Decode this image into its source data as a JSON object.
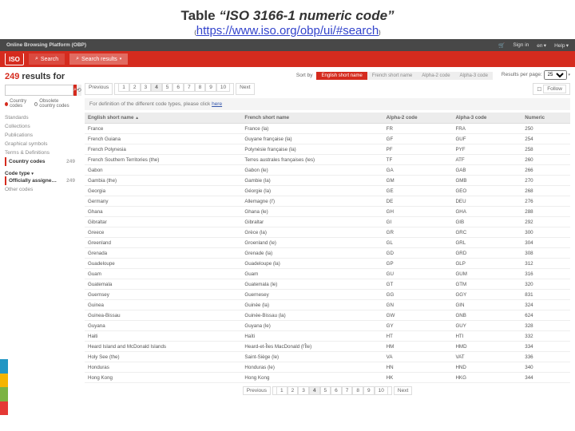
{
  "slide": {
    "title_prefix": "Table ",
    "title_quoted": "“ISO 3166-1 numeric code”",
    "url_text": "https://www.iso.org/obp/ui/#search"
  },
  "topbar": {
    "brand": "Online Browsing Platform (OBP)",
    "cart_icon": "cart-icon",
    "signin": "Sign in",
    "lang": "en ▾",
    "help": "Help ▾"
  },
  "redbar": {
    "logo": "ISO",
    "search_tab": "Search",
    "results_tab": "Search results"
  },
  "sidebar": {
    "results_count": "249",
    "results_label": "results for",
    "search_placeholder": "",
    "tab_country": "Country codes",
    "tab_obsolete": "Obsolete country codes",
    "items": [
      {
        "label": "Standards",
        "count": ""
      },
      {
        "label": "Collections",
        "count": ""
      },
      {
        "label": "Publications",
        "count": ""
      },
      {
        "label": "Graphical symbols",
        "count": ""
      },
      {
        "label": "Terms & Definitions",
        "count": ""
      },
      {
        "label": "Country codes",
        "count": "249"
      }
    ],
    "group2_label": "Code type",
    "group2_items": [
      {
        "label": "Officially assigne…",
        "count": "249"
      },
      {
        "label": "Other codes",
        "count": ""
      }
    ]
  },
  "sortbar": {
    "label": "Sort by",
    "chips": [
      "English short name",
      "French short name",
      "Alpha-2 code",
      "Alpha-3 code"
    ],
    "rpp_label": "Results per page:",
    "rpp_value": "25"
  },
  "pager": {
    "prev": "Previous",
    "pages": [
      "1",
      "2",
      "3",
      "4",
      "5",
      "6",
      "7",
      "8",
      "9",
      "10"
    ],
    "next": "Next",
    "current": "4",
    "follow": "Follow"
  },
  "note": {
    "text": "For definition of the different code types, please click ",
    "link": "here"
  },
  "table": {
    "headers": [
      "English short name",
      "French short name",
      "Alpha-2 code",
      "Alpha-3 code",
      "Numeric"
    ],
    "rows": [
      [
        "France",
        "France (la)",
        "FR",
        "FRA",
        "250"
      ],
      [
        "French Guiana",
        "Guyane française (la)",
        "GF",
        "GUF",
        "254"
      ],
      [
        "French Polynesia",
        "Polynésie française (la)",
        "PF",
        "PYF",
        "258"
      ],
      [
        "French Southern Territories (the)",
        "Terres australes françaises (les)",
        "TF",
        "ATF",
        "260"
      ],
      [
        "Gabon",
        "Gabon (le)",
        "GA",
        "GAB",
        "266"
      ],
      [
        "Gambia (the)",
        "Gambie (la)",
        "GM",
        "GMB",
        "270"
      ],
      [
        "Georgia",
        "Géorgie (la)",
        "GE",
        "GEO",
        "268"
      ],
      [
        "Germany",
        "Allemagne (l')",
        "DE",
        "DEU",
        "276"
      ],
      [
        "Ghana",
        "Ghana (le)",
        "GH",
        "GHA",
        "288"
      ],
      [
        "Gibraltar",
        "Gibraltar",
        "GI",
        "GIB",
        "292"
      ],
      [
        "Greece",
        "Grèce (la)",
        "GR",
        "GRC",
        "300"
      ],
      [
        "Greenland",
        "Groenland (le)",
        "GL",
        "GRL",
        "304"
      ],
      [
        "Grenada",
        "Grenade (la)",
        "GD",
        "GRD",
        "308"
      ],
      [
        "Guadeloupe",
        "Guadeloupe (la)",
        "GP",
        "GLP",
        "312"
      ],
      [
        "Guam",
        "Guam",
        "GU",
        "GUM",
        "316"
      ],
      [
        "Guatemala",
        "Guatemala (le)",
        "GT",
        "GTM",
        "320"
      ],
      [
        "Guernsey",
        "Guernesey",
        "GG",
        "GGY",
        "831"
      ],
      [
        "Guinea",
        "Guinée (la)",
        "GN",
        "GIN",
        "324"
      ],
      [
        "Guinea-Bissau",
        "Guinée-Bissau (la)",
        "GW",
        "GNB",
        "624"
      ],
      [
        "Guyana",
        "Guyana (le)",
        "GY",
        "GUY",
        "328"
      ],
      [
        "Haiti",
        "Haïti",
        "HT",
        "HTI",
        "332"
      ],
      [
        "Heard Island and McDonald Islands",
        "Heard-et-Îles MacDonald (l'Île)",
        "HM",
        "HMD",
        "334"
      ],
      [
        "Holy See (the)",
        "Saint-Siège (le)",
        "VA",
        "VAT",
        "336"
      ],
      [
        "Honduras",
        "Honduras (le)",
        "HN",
        "HND",
        "340"
      ],
      [
        "Hong Kong",
        "Hong Kong",
        "HK",
        "HKG",
        "344"
      ]
    ]
  },
  "chart_data": {
    "type": "table",
    "title": "ISO 3166-1 numeric code",
    "columns": [
      "English short name",
      "French short name",
      "Alpha-2 code",
      "Alpha-3 code",
      "Numeric"
    ],
    "rows": [
      [
        "France",
        "France (la)",
        "FR",
        "FRA",
        250
      ],
      [
        "French Guiana",
        "Guyane française (la)",
        "GF",
        "GUF",
        254
      ],
      [
        "French Polynesia",
        "Polynésie française (la)",
        "PF",
        "PYF",
        258
      ],
      [
        "French Southern Territories (the)",
        "Terres australes françaises (les)",
        "TF",
        "ATF",
        260
      ],
      [
        "Gabon",
        "Gabon (le)",
        "GA",
        "GAB",
        266
      ],
      [
        "Gambia (the)",
        "Gambie (la)",
        "GM",
        "GMB",
        270
      ],
      [
        "Georgia",
        "Géorgie (la)",
        "GE",
        "GEO",
        268
      ],
      [
        "Germany",
        "Allemagne (l')",
        "DE",
        "DEU",
        276
      ],
      [
        "Ghana",
        "Ghana (le)",
        "GH",
        "GHA",
        288
      ],
      [
        "Gibraltar",
        "Gibraltar",
        "GI",
        "GIB",
        292
      ],
      [
        "Greece",
        "Grèce (la)",
        "GR",
        "GRC",
        300
      ],
      [
        "Greenland",
        "Groenland (le)",
        "GL",
        "GRL",
        304
      ],
      [
        "Grenada",
        "Grenade (la)",
        "GD",
        "GRD",
        308
      ],
      [
        "Guadeloupe",
        "Guadeloupe (la)",
        "GP",
        "GLP",
        312
      ],
      [
        "Guam",
        "Guam",
        "GU",
        "GUM",
        316
      ],
      [
        "Guatemala",
        "Guatemala (le)",
        "GT",
        "GTM",
        320
      ],
      [
        "Guernsey",
        "Guernesey",
        "GG",
        "GGY",
        831
      ],
      [
        "Guinea",
        "Guinée (la)",
        "GN",
        "GIN",
        324
      ],
      [
        "Guinea-Bissau",
        "Guinée-Bissau (la)",
        "GW",
        "GNB",
        624
      ],
      [
        "Guyana",
        "Guyana (le)",
        "GY",
        "GUY",
        328
      ],
      [
        "Haiti",
        "Haïti",
        "HT",
        "HTI",
        332
      ],
      [
        "Heard Island and McDonald Islands",
        "Heard-et-Îles MacDonald (l'Île)",
        "HM",
        "HMD",
        334
      ],
      [
        "Holy See (the)",
        "Saint-Siège (le)",
        "VA",
        "VAT",
        336
      ],
      [
        "Honduras",
        "Honduras (le)",
        "HN",
        "HND",
        340
      ],
      [
        "Hong Kong",
        "Hong Kong",
        "HK",
        "HKG",
        344
      ]
    ]
  },
  "stripe_colors": [
    "#2196c4",
    "#f5b400",
    "#7cb342",
    "#e53935"
  ]
}
